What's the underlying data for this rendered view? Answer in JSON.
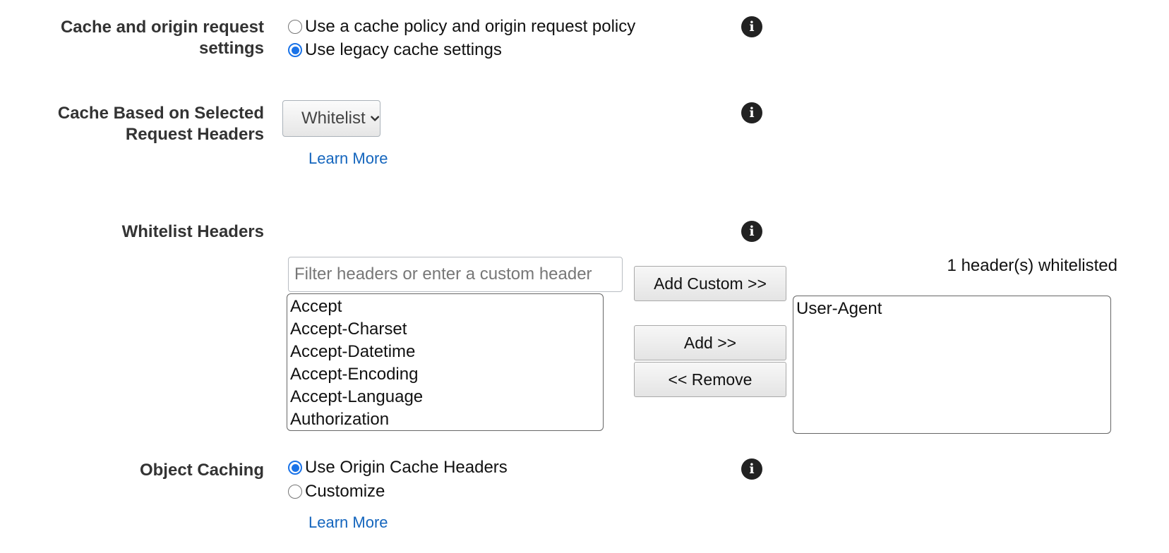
{
  "cache_settings": {
    "label": "Cache and origin request settings",
    "label_line1": "Cache and origin request",
    "label_line2": "settings",
    "options": [
      {
        "label": "Use a cache policy and origin request policy",
        "selected": false
      },
      {
        "label": "Use legacy cache settings",
        "selected": true
      }
    ],
    "info_glyph": "i"
  },
  "cache_headers": {
    "label_line1": "Cache Based on Selected",
    "label_line2": "Request Headers",
    "dropdown_value": "Whitelist",
    "learn_more": "Learn More",
    "info_glyph": "i"
  },
  "whitelist_headers": {
    "label": "Whitelist Headers",
    "info_glyph": "i",
    "filter_placeholder": "Filter headers or enter a custom header",
    "filter_value": "",
    "available": [
      "Accept",
      "Accept-Charset",
      "Accept-Datetime",
      "Accept-Encoding",
      "Accept-Language",
      "Authorization"
    ],
    "buttons": {
      "add_custom": "Add Custom >>",
      "add": "Add >>",
      "remove": "<< Remove"
    },
    "count_text": "1 header(s) whitelisted",
    "selected": [
      "User-Agent"
    ]
  },
  "object_caching": {
    "label": "Object Caching",
    "options": [
      {
        "label": "Use Origin Cache Headers",
        "selected": true
      },
      {
        "label": "Customize",
        "selected": false
      }
    ],
    "learn_more": "Learn More",
    "info_glyph": "i"
  },
  "colors": {
    "accent": "#1a73e8",
    "link": "#1465bd"
  }
}
